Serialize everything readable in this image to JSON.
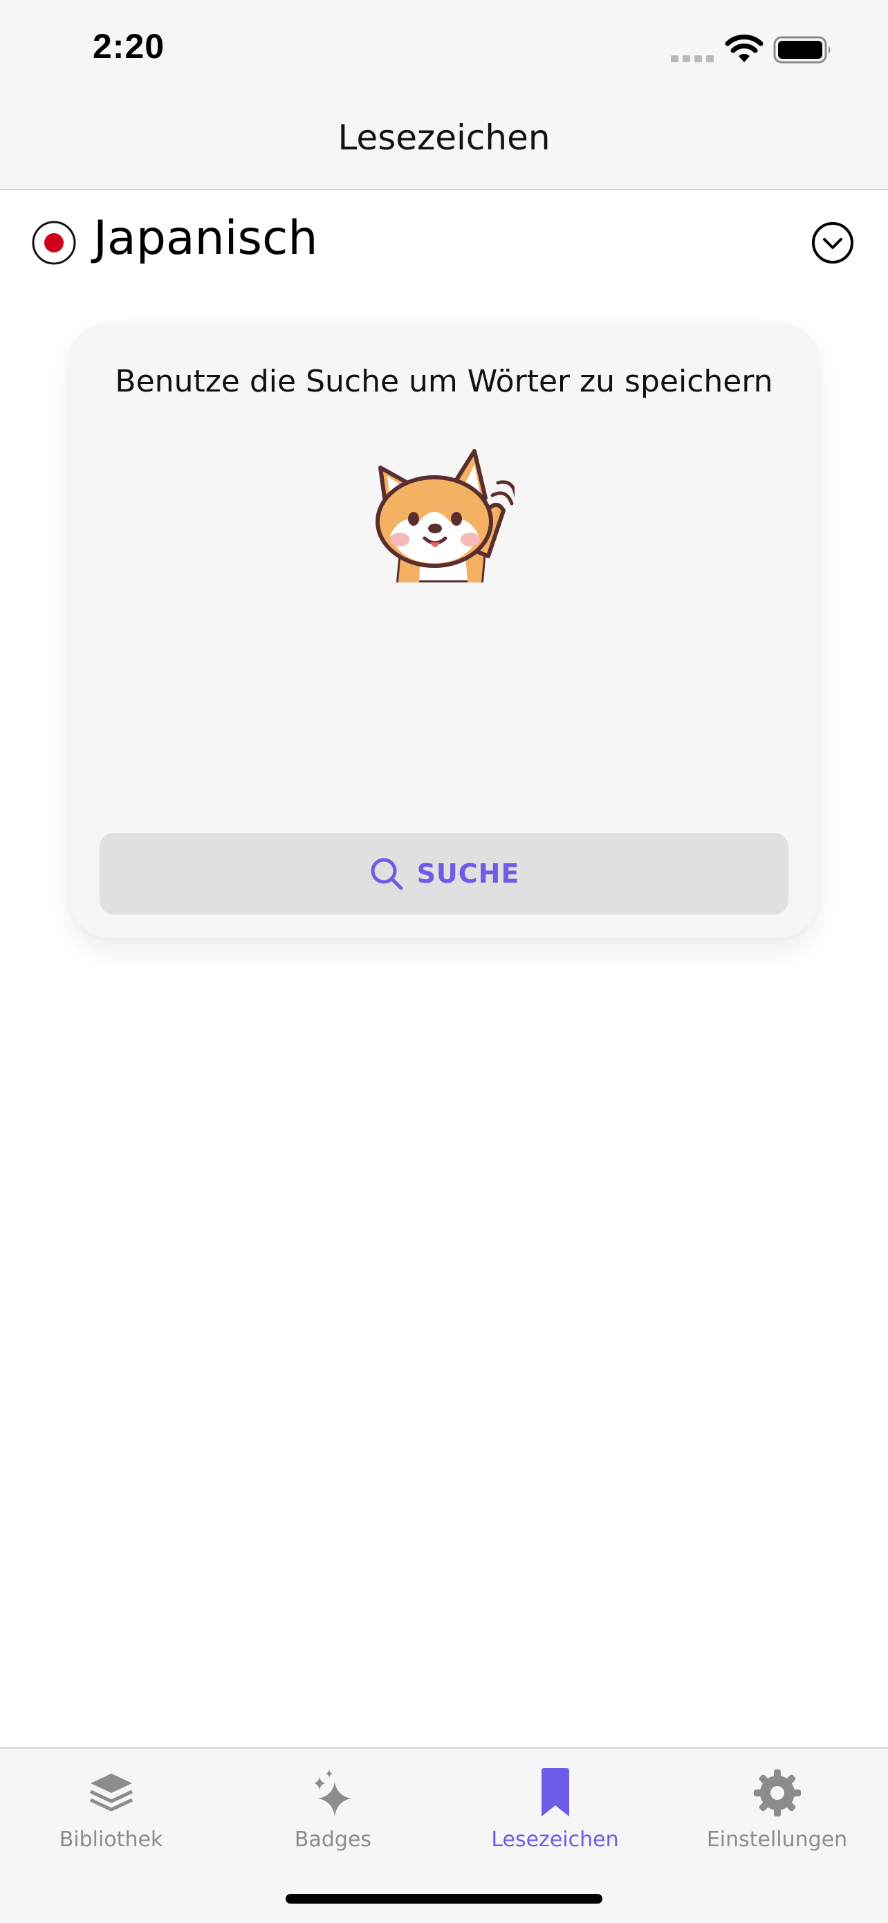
{
  "status_bar": {
    "time": "2:20"
  },
  "header": {
    "title": "Lesezeichen"
  },
  "language": {
    "name": "Japanisch"
  },
  "card": {
    "message": "Benutze die Suche um Wörter zu speichern",
    "search_button_label": "SUCHE"
  },
  "tabs": [
    {
      "label": "Bibliothek",
      "icon": "stack-icon",
      "active": false
    },
    {
      "label": "Badges",
      "icon": "sparkles-icon",
      "active": false
    },
    {
      "label": "Lesezeichen",
      "icon": "bookmark-icon",
      "active": true
    },
    {
      "label": "Einstellungen",
      "icon": "gear-icon",
      "active": false
    }
  ],
  "colors": {
    "accent": "#6c5ce7",
    "inactive": "#8c8c8c",
    "flag_red": "#d0021b",
    "bar_background": "#f6f6f6"
  }
}
